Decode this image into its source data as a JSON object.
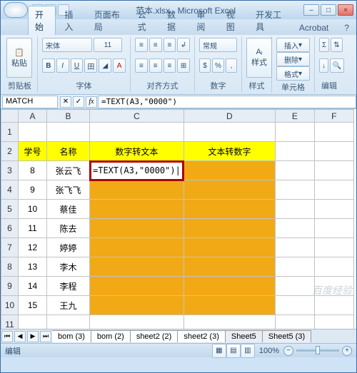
{
  "window": {
    "title": "范本.xlsx - Microsoft Excel"
  },
  "tabs": [
    "开始",
    "插入",
    "页面布局",
    "公式",
    "数据",
    "审阅",
    "视图",
    "开发工具",
    "Acrobat"
  ],
  "activeTab": 0,
  "ribbon": {
    "paste": "粘贴",
    "clipboard": "剪贴板",
    "font": {
      "name": "宋体",
      "size": "11",
      "group": "字体",
      "bold": "B",
      "italic": "I",
      "underline": "U"
    },
    "align": {
      "group": "对齐方式",
      "wrap": "常规"
    },
    "number": {
      "group": "数字",
      "format": "常规"
    },
    "styles": {
      "group": "样式",
      "btn": "样式"
    },
    "cells": {
      "group": "单元格",
      "insert": "插入",
      "delete": "删除",
      "format": "格式"
    },
    "editing": {
      "group": "编辑"
    }
  },
  "nameBox": "MATCH",
  "formula": "=TEXT(A3,\"0000\")",
  "columns": [
    "A",
    "B",
    "C",
    "D",
    "E",
    "F"
  ],
  "headers": {
    "r1": "",
    "A": "学号",
    "B": "名称",
    "C": "数字转文本",
    "D": "文本转数字"
  },
  "rows": [
    {
      "n": "3",
      "a": "8",
      "b": "张云飞",
      "c": "=TEXT(A3,\"0000\")",
      "editing": true
    },
    {
      "n": "4",
      "a": "9",
      "b": "张飞飞",
      "c": ""
    },
    {
      "n": "5",
      "a": "10",
      "b": "蔡佳",
      "c": ""
    },
    {
      "n": "6",
      "a": "11",
      "b": "陈去",
      "c": ""
    },
    {
      "n": "7",
      "a": "12",
      "b": "婷婷",
      "c": ""
    },
    {
      "n": "8",
      "a": "13",
      "b": "李木",
      "c": ""
    },
    {
      "n": "9",
      "a": "14",
      "b": "李程",
      "c": ""
    },
    {
      "n": "10",
      "a": "15",
      "b": "王九",
      "c": ""
    }
  ],
  "sheetTabs": [
    "bom (3)",
    "bom (2)",
    "sheet2 (2)",
    "sheet2 (3)",
    "Sheet5",
    "Sheet5 (3)"
  ],
  "status": {
    "mode": "编辑",
    "zoom": "100%"
  }
}
